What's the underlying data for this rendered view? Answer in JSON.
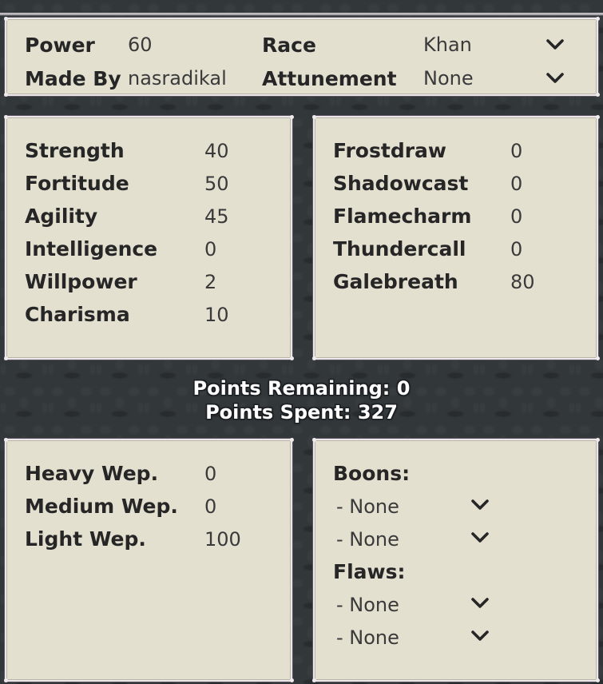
{
  "theme": {
    "background": "#32373A",
    "panel_face": "#E3E0D0",
    "panel_border": "#ECE7EA",
    "text": "#262626",
    "value_text": "#3A3A3A",
    "points_text": "#FFFFFF"
  },
  "header": {
    "rows": [
      {
        "label": "Power",
        "value": "60",
        "label2": "Race",
        "value2": "Khan",
        "dropdown_icon": "chevron-down-icon"
      },
      {
        "label": "Made By",
        "value": "nasradikal",
        "label2": "Attunement",
        "value2": "None",
        "dropdown_icon": "chevron-down-icon"
      }
    ]
  },
  "stats_left": {
    "rows": [
      {
        "name": "Strength",
        "value": "40"
      },
      {
        "name": "Fortitude",
        "value": "50"
      },
      {
        "name": "Agility",
        "value": "45"
      },
      {
        "name": "Intelligence",
        "value": "0"
      },
      {
        "name": "Willpower",
        "value": "2"
      },
      {
        "name": "Charisma",
        "value": "10"
      }
    ]
  },
  "stats_right": {
    "rows": [
      {
        "name": "Frostdraw",
        "value": "0"
      },
      {
        "name": "Shadowcast",
        "value": "0"
      },
      {
        "name": "Flamecharm",
        "value": "0"
      },
      {
        "name": "Thundercall",
        "value": "0"
      },
      {
        "name": "Galebreath",
        "value": "80"
      }
    ]
  },
  "points": {
    "remaining_line": "Points Remaining: 0",
    "spent_line": "Points Spent: 327",
    "remaining": 0,
    "spent": 327
  },
  "weapons": {
    "rows": [
      {
        "name": "Heavy Wep.",
        "value": "0"
      },
      {
        "name": "Medium Wep.",
        "value": "0"
      },
      {
        "name": "Light Wep.",
        "value": "100"
      }
    ]
  },
  "traits": {
    "boons_heading": "Boons:",
    "boons": [
      {
        "text": "- None",
        "dropdown_icon": "chevron-down-icon"
      },
      {
        "text": "- None",
        "dropdown_icon": "chevron-down-icon"
      }
    ],
    "flaws_heading": "Flaws:",
    "flaws": [
      {
        "text": "- None",
        "dropdown_icon": "chevron-down-icon"
      },
      {
        "text": "- None",
        "dropdown_icon": "chevron-down-icon"
      }
    ]
  }
}
